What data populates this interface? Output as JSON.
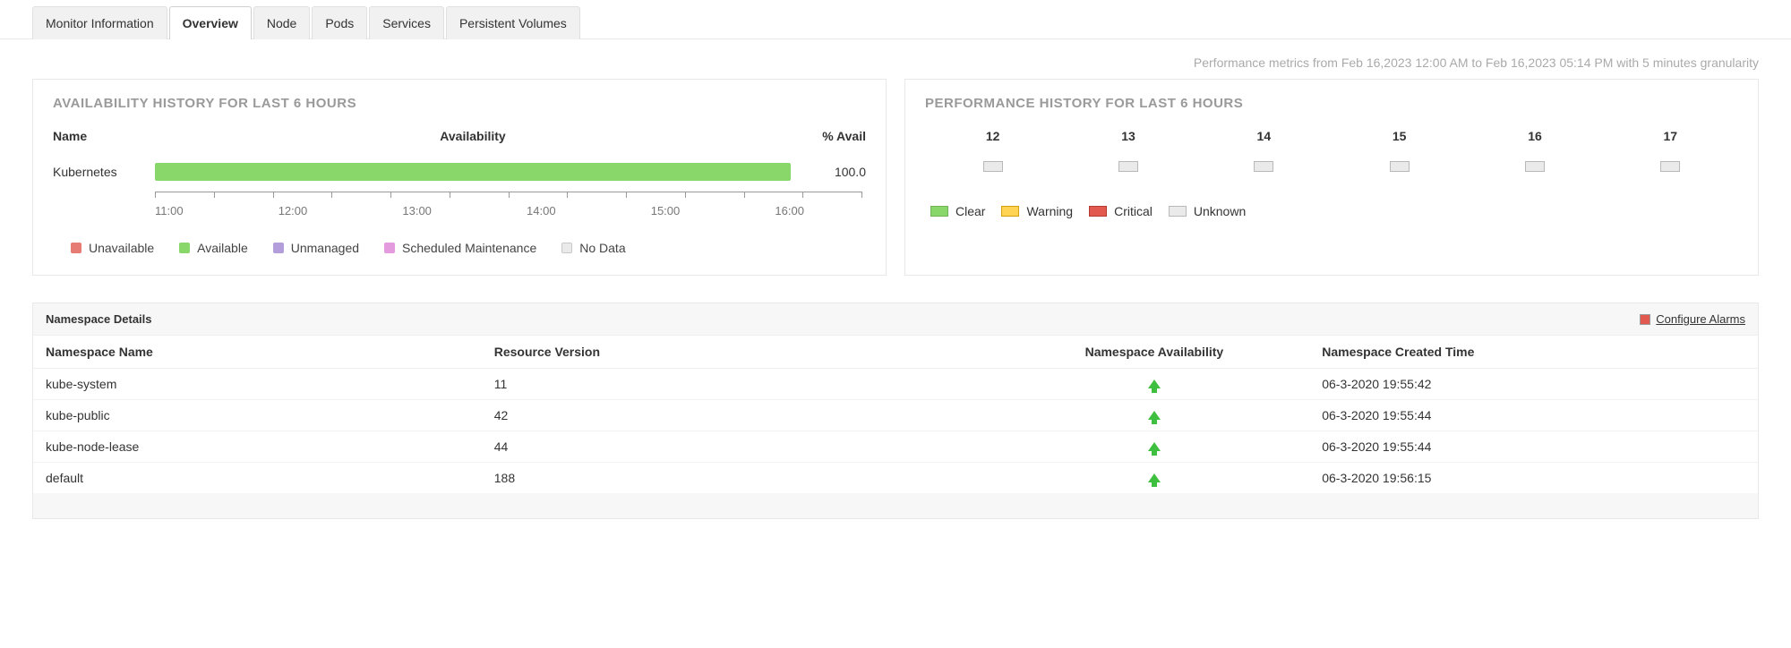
{
  "tabs": {
    "items": [
      {
        "label": "Monitor Information"
      },
      {
        "label": "Overview"
      },
      {
        "label": "Node"
      },
      {
        "label": "Pods"
      },
      {
        "label": "Services"
      },
      {
        "label": "Persistent Volumes"
      }
    ],
    "active_index": 1
  },
  "metrics_line": "Performance metrics from Feb 16,2023 12:00 AM to Feb 16,2023 05:14 PM with 5 minutes granularity",
  "availability": {
    "title": "AVAILABILITY HISTORY FOR LAST 6 HOURS",
    "columns": {
      "name": "Name",
      "avail": "Availability",
      "pct": "% Avail"
    },
    "row": {
      "name": "Kubernetes",
      "pct": "100.0",
      "pct_value": 100
    },
    "ticks": [
      "11:00",
      "12:00",
      "13:00",
      "14:00",
      "15:00",
      "16:00"
    ],
    "legend": [
      {
        "label": "Unavailable",
        "cls": "red"
      },
      {
        "label": "Available",
        "cls": "green"
      },
      {
        "label": "Unmanaged",
        "cls": "purple"
      },
      {
        "label": "Scheduled Maintenance",
        "cls": "magenta"
      },
      {
        "label": "No Data",
        "cls": "grey"
      }
    ]
  },
  "performance": {
    "title": "PERFORMANCE HISTORY FOR LAST 6 HOURS",
    "hours": [
      "12",
      "13",
      "14",
      "15",
      "16",
      "17"
    ],
    "states": [
      "unknown",
      "unknown",
      "unknown",
      "unknown",
      "unknown",
      "unknown"
    ],
    "legend": [
      {
        "label": "Clear",
        "cls": "clear"
      },
      {
        "label": "Warning",
        "cls": "warn"
      },
      {
        "label": "Critical",
        "cls": "crit"
      },
      {
        "label": "Unknown",
        "cls": "unk"
      }
    ]
  },
  "namespaces": {
    "title": "Namespace Details",
    "configure_label": "Configure Alarms",
    "columns": {
      "name": "Namespace Name",
      "rv": "Resource Version",
      "avail": "Namespace Availability",
      "created": "Namespace Created Time"
    },
    "rows": [
      {
        "name": "kube-system",
        "rv": "11",
        "avail": "up",
        "created": "06-3-2020 19:55:42"
      },
      {
        "name": "kube-public",
        "rv": "42",
        "avail": "up",
        "created": "06-3-2020 19:55:44"
      },
      {
        "name": "kube-node-lease",
        "rv": "44",
        "avail": "up",
        "created": "06-3-2020 19:55:44"
      },
      {
        "name": "default",
        "rv": "188",
        "avail": "up",
        "created": "06-3-2020 19:56:15"
      }
    ]
  },
  "chart_data": [
    {
      "type": "bar",
      "title": "Availability history for last 6 hours — Kubernetes",
      "categories": [
        "11:00",
        "12:00",
        "13:00",
        "14:00",
        "15:00",
        "16:00"
      ],
      "series": [
        {
          "name": "Available %",
          "values": [
            100,
            100,
            100,
            100,
            100,
            100
          ]
        }
      ],
      "ylim": [
        0,
        100
      ],
      "ylabel": "% Available"
    },
    {
      "type": "heatmap",
      "title": "Performance history for last 6 hours",
      "categories": [
        "12",
        "13",
        "14",
        "15",
        "16",
        "17"
      ],
      "values": [
        "Unknown",
        "Unknown",
        "Unknown",
        "Unknown",
        "Unknown",
        "Unknown"
      ],
      "legend": [
        "Clear",
        "Warning",
        "Critical",
        "Unknown"
      ]
    }
  ]
}
